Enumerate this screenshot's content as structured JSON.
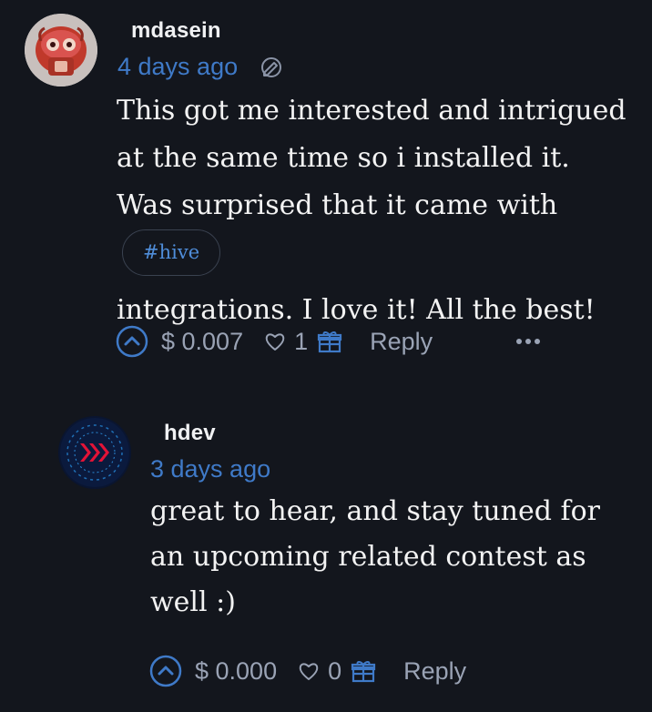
{
  "comments": [
    {
      "username": "mdasein",
      "timestamp": "4 days ago",
      "text_before_tag": "This got me interested and intrigued at the same time so i installed it. Was surprised that it came with",
      "tag": "#hive",
      "text_after_tag": "integrations. I love it! All the best!",
      "payout": "$ 0.007",
      "votes": "1",
      "reply_label": "Reply"
    },
    {
      "username": "hdev",
      "timestamp": "3 days ago",
      "text": "great to hear, and stay tuned for an upcoming related contest as well :)",
      "payout": "$ 0.000",
      "votes": "0",
      "reply_label": "Reply"
    }
  ],
  "colors": {
    "background": "#13161d",
    "link": "#3f7ac8",
    "muted": "#9aa3b5",
    "tag_border": "#3a4250"
  },
  "icons": {
    "edit": "edit-pen-icon",
    "upvote": "upvote-circle-icon",
    "heart": "heart-icon",
    "gift": "gift-icon",
    "more": "more-horizontal-icon"
  }
}
